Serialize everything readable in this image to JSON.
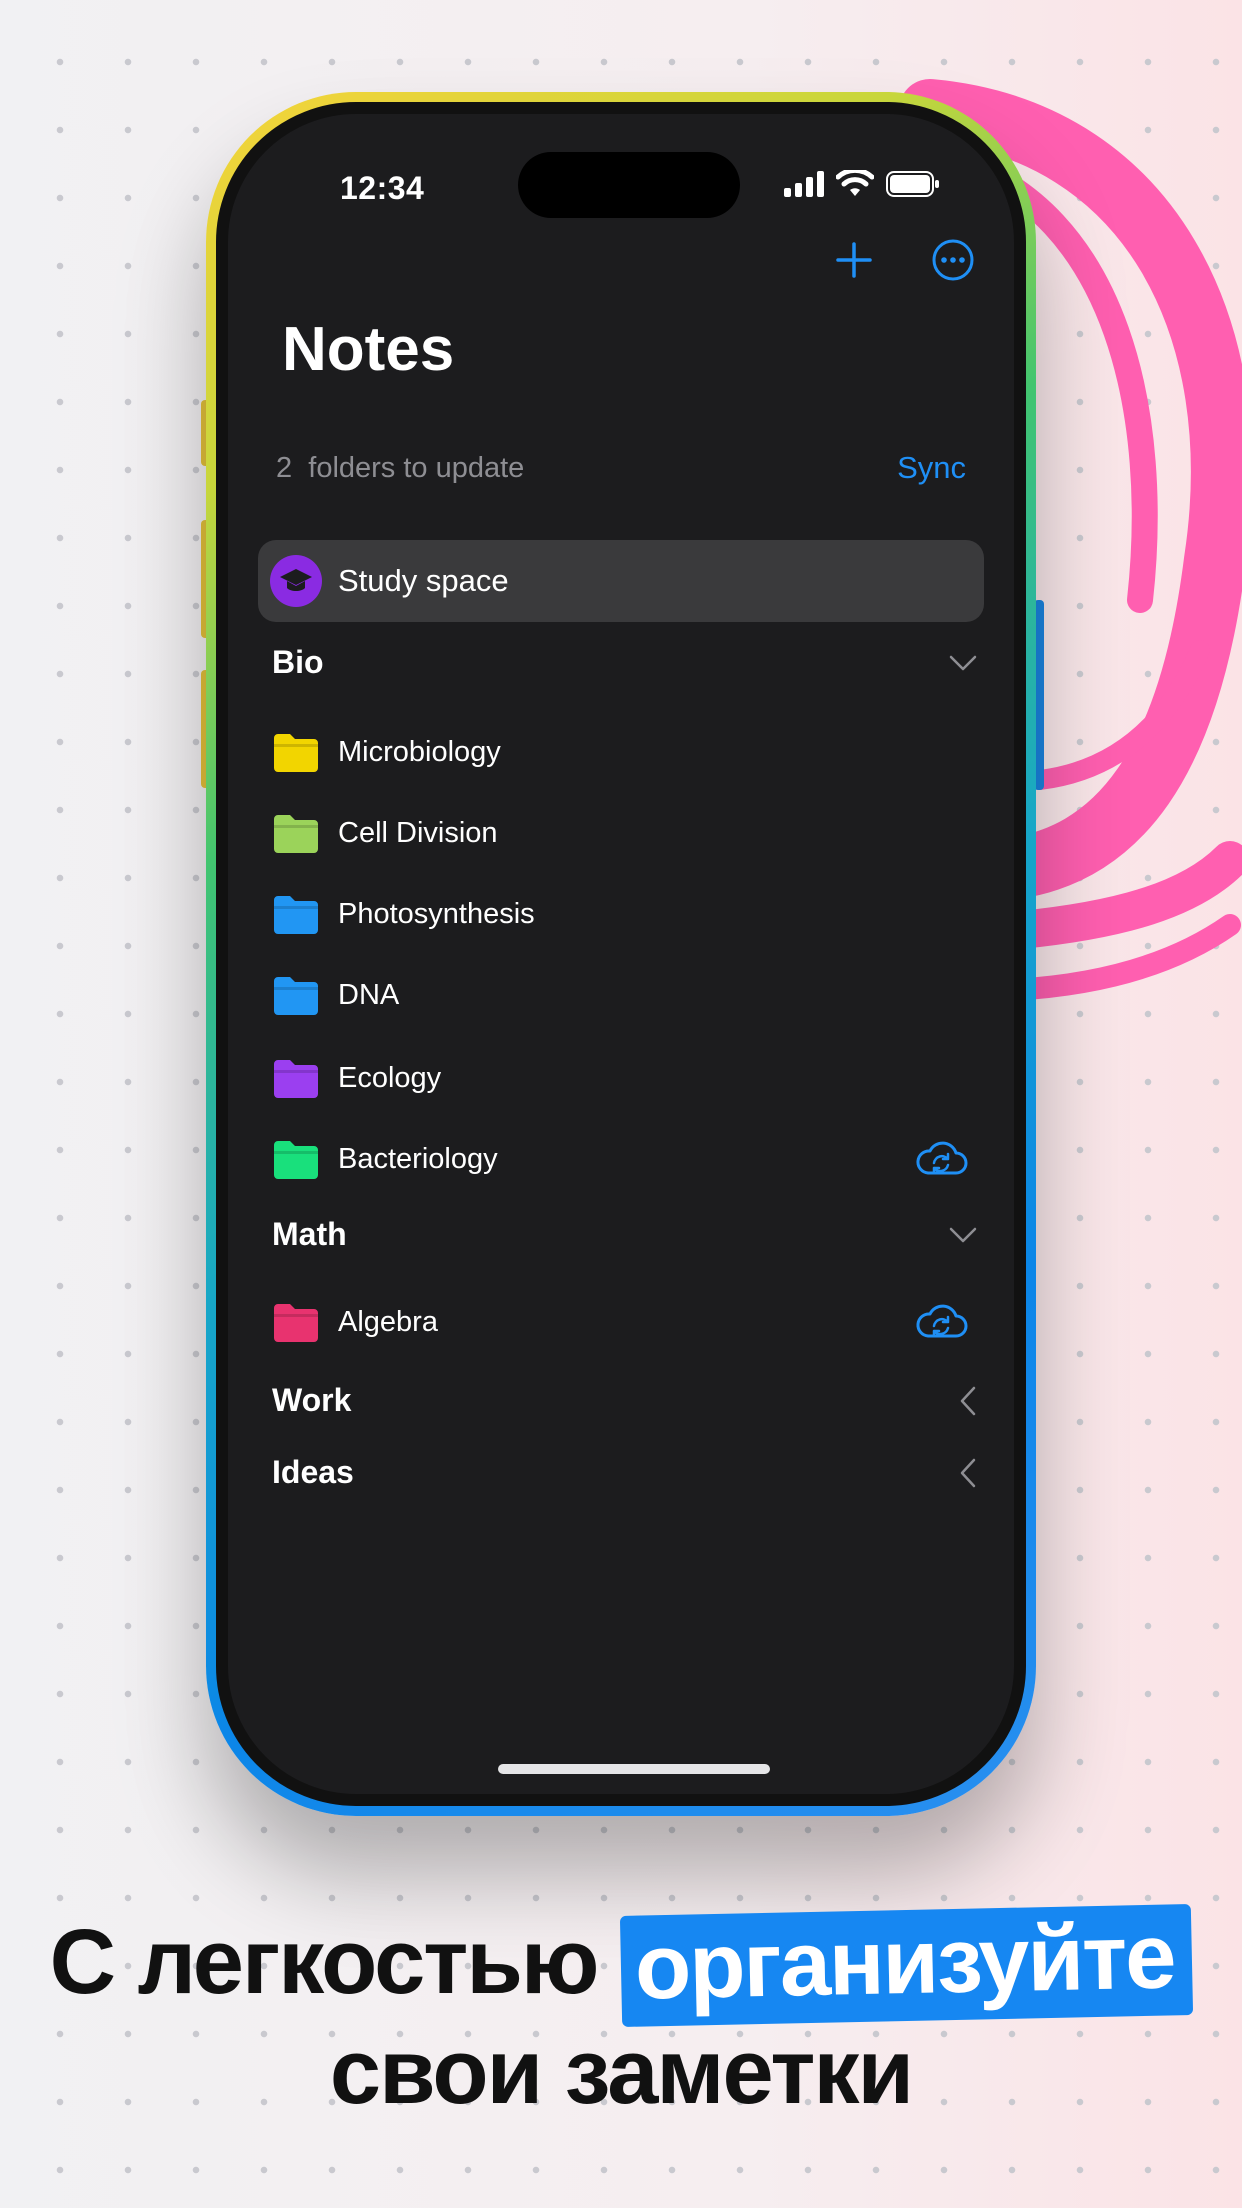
{
  "status_bar": {
    "time": "12:34"
  },
  "header": {
    "title": "Notes",
    "add_icon": "plus-icon",
    "more_icon": "ellipsis-circle-icon"
  },
  "update_banner": {
    "count": "2",
    "text": "folders to update",
    "sync_label": "Sync"
  },
  "study_space": {
    "label": "Study space",
    "icon": "graduation-cap-icon",
    "icon_color": "#8a2be2"
  },
  "sections": [
    {
      "label": "Bio",
      "state": "expanded",
      "folders": [
        {
          "label": "Microbiology",
          "color": "#f2d500",
          "sync_pending": false
        },
        {
          "label": "Cell Division",
          "color": "#9bd35a",
          "sync_pending": false
        },
        {
          "label": "Photosynthesis",
          "color": "#2196f3",
          "sync_pending": false
        },
        {
          "label": "DNA",
          "color": "#2196f3",
          "sync_pending": false
        },
        {
          "label": "Ecology",
          "color": "#9b3ff0",
          "sync_pending": false
        },
        {
          "label": "Bacteriology",
          "color": "#19e07c",
          "sync_pending": true
        }
      ]
    },
    {
      "label": "Math",
      "state": "expanded",
      "folders": [
        {
          "label": "Algebra",
          "color": "#e8336f",
          "sync_pending": true
        }
      ]
    },
    {
      "label": "Work",
      "state": "collapsed",
      "folders": []
    },
    {
      "label": "Ideas",
      "state": "collapsed",
      "folders": []
    }
  ],
  "caption": {
    "line1_part1": "С легкостью",
    "line1_highlight": "организуйте",
    "line2": "свои заметки"
  },
  "colors": {
    "accent": "#1f8ff5",
    "background": "#1c1c1e",
    "row_highlight": "#3a3a3c",
    "decoration": "#ff5fb0"
  }
}
